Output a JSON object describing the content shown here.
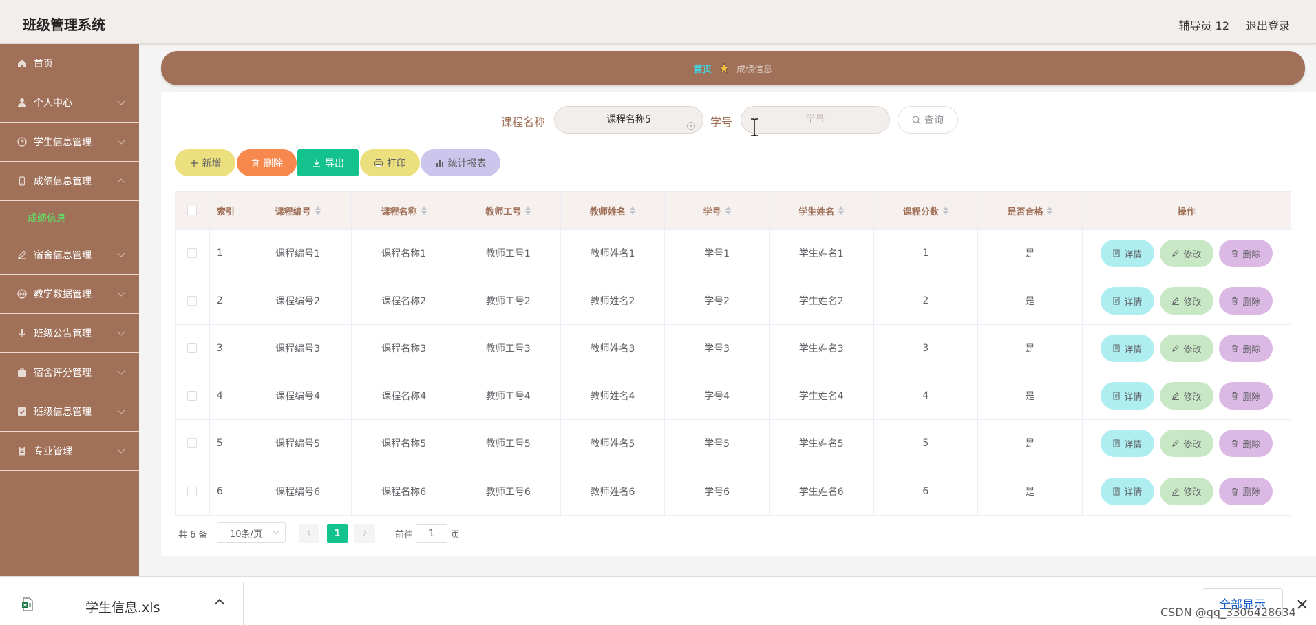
{
  "header": {
    "app_title": "班级管理系统",
    "user": "辅导员 12",
    "logout": "退出登录"
  },
  "sidebar": {
    "items": [
      {
        "label": "首页",
        "icon": "home-icon",
        "has_arrow": false
      },
      {
        "label": "个人中心",
        "icon": "user-icon",
        "has_arrow": true
      },
      {
        "label": "学生信息管理",
        "icon": "clock-icon",
        "has_arrow": true
      },
      {
        "label": "成绩信息管理",
        "icon": "phone-icon",
        "has_arrow": true,
        "expanded": true
      },
      {
        "label": "宿舍信息管理",
        "icon": "edit-icon",
        "has_arrow": true
      },
      {
        "label": "教学数据管理",
        "icon": "globe-icon",
        "has_arrow": true
      },
      {
        "label": "班级公告管理",
        "icon": "mic-icon",
        "has_arrow": true
      },
      {
        "label": "宿舍评分管理",
        "icon": "briefcase-icon",
        "has_arrow": true
      },
      {
        "label": "班级信息管理",
        "icon": "check-square-icon",
        "has_arrow": true
      },
      {
        "label": "专业管理",
        "icon": "clipboard-icon",
        "has_arrow": true
      }
    ],
    "submenu": {
      "label": "成绩信息"
    }
  },
  "breadcrumb": {
    "home": "首页",
    "current": "成绩信息"
  },
  "search": {
    "course_label": "课程名称",
    "course_value": "课程名称5",
    "student_label": "学号",
    "student_placeholder": "学号",
    "query_label": "查询"
  },
  "toolbar": {
    "add": "新增",
    "delete": "删除",
    "export": "导出",
    "print": "打印",
    "report": "统计报表"
  },
  "table": {
    "headers": [
      "索引",
      "课程编号",
      "课程名称",
      "教师工号",
      "教师姓名",
      "学号",
      "学生姓名",
      "课程分数",
      "是否合格",
      "操作"
    ],
    "rows": [
      {
        "idx": "1",
        "course_no": "课程编号1",
        "course_name": "课程名称1",
        "teacher_no": "教师工号1",
        "teacher_name": "教师姓名1",
        "student_no": "学号1",
        "student_name": "学生姓名1",
        "score": "1",
        "pass": "是"
      },
      {
        "idx": "2",
        "course_no": "课程编号2",
        "course_name": "课程名称2",
        "teacher_no": "教师工号2",
        "teacher_name": "教师姓名2",
        "student_no": "学号2",
        "student_name": "学生姓名2",
        "score": "2",
        "pass": "是"
      },
      {
        "idx": "3",
        "course_no": "课程编号3",
        "course_name": "课程名称3",
        "teacher_no": "教师工号3",
        "teacher_name": "教师姓名3",
        "student_no": "学号3",
        "student_name": "学生姓名3",
        "score": "3",
        "pass": "是"
      },
      {
        "idx": "4",
        "course_no": "课程编号4",
        "course_name": "课程名称4",
        "teacher_no": "教师工号4",
        "teacher_name": "教师姓名4",
        "student_no": "学号4",
        "student_name": "学生姓名4",
        "score": "4",
        "pass": "是"
      },
      {
        "idx": "5",
        "course_no": "课程编号5",
        "course_name": "课程名称5",
        "teacher_no": "教师工号5",
        "teacher_name": "教师姓名5",
        "student_no": "学号5",
        "student_name": "学生姓名5",
        "score": "5",
        "pass": "是"
      },
      {
        "idx": "6",
        "course_no": "课程编号6",
        "course_name": "课程名称6",
        "teacher_no": "教师工号6",
        "teacher_name": "教师姓名6",
        "student_no": "学号6",
        "student_name": "学生姓名6",
        "score": "6",
        "pass": "是"
      }
    ],
    "ops": {
      "detail": "详情",
      "edit": "修改",
      "delete": "删除"
    }
  },
  "pagination": {
    "total": "共 6 条",
    "page_size": "10条/页",
    "current_page": "1",
    "goto_prefix": "前往",
    "goto_value": "1",
    "goto_suffix": "页"
  },
  "download_bar": {
    "file_name": "学生信息.xls",
    "show_all": "全部显示"
  },
  "watermark": "CSDN @qq_3306428634",
  "colors": {
    "brand_brown": "#a07058",
    "accent_cyan": "#3fd8e6",
    "active_green": "#5ee86a",
    "pager_green": "#13c28c",
    "btn_add": "#ece07e",
    "btn_delete": "#f7894f",
    "btn_export": "#13c28c",
    "btn_print": "#ece07e",
    "btn_report": "#cdc6ec"
  }
}
